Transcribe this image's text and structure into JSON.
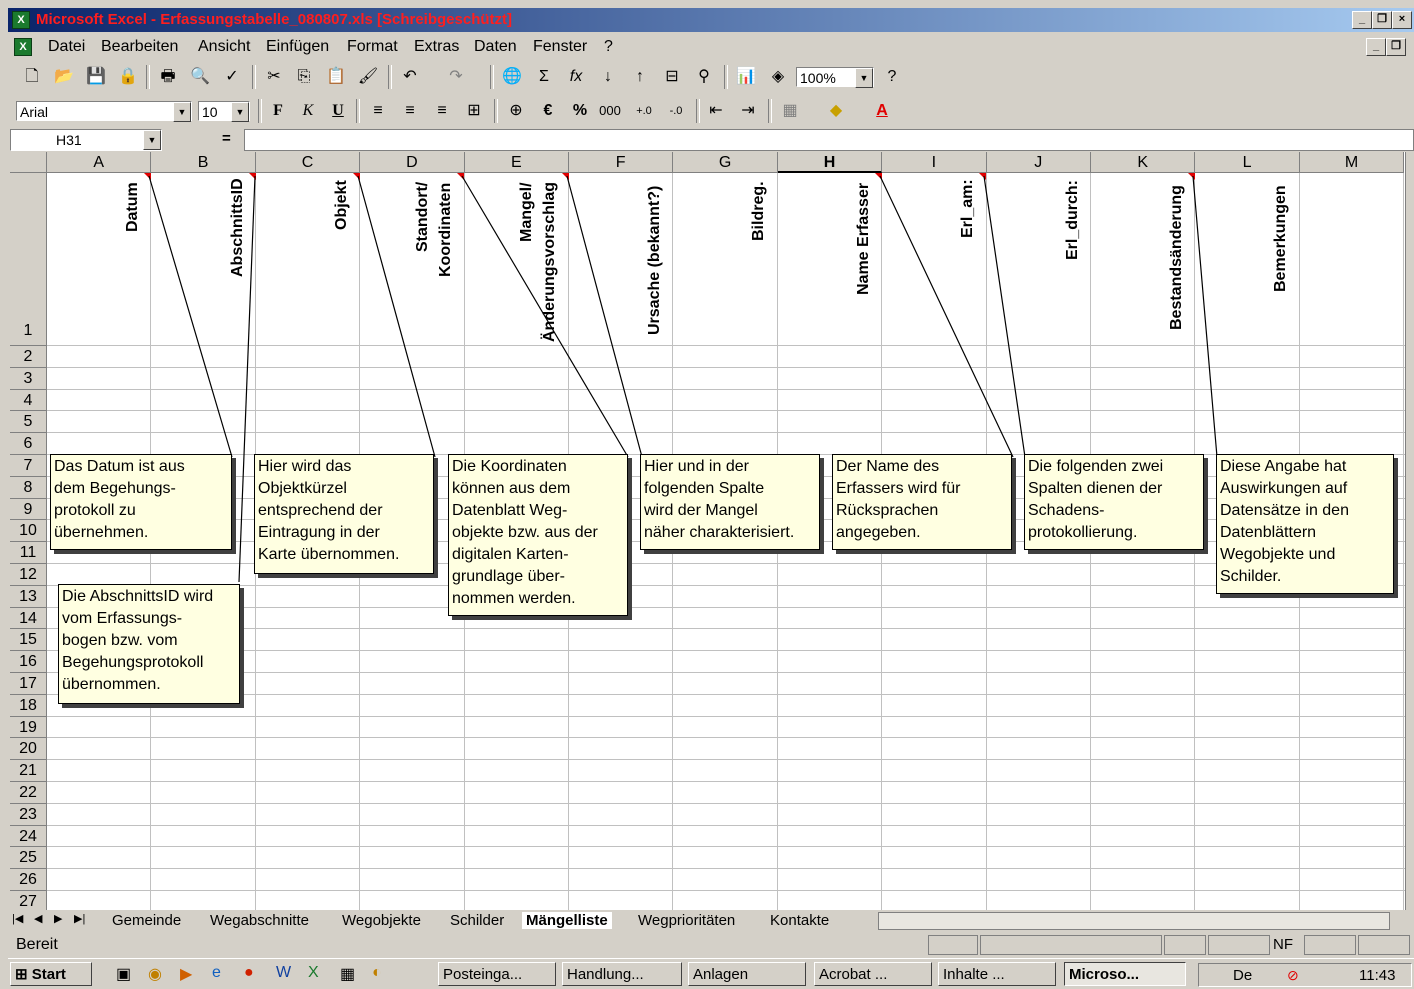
{
  "window": {
    "title": "Microsoft Excel - Erfassungstabelle_080807.xls  [Schreibgeschützt]"
  },
  "menu": [
    "Datei",
    "Bearbeiten",
    "Ansicht",
    "Einfügen",
    "Format",
    "Extras",
    "Daten",
    "Fenster",
    "?"
  ],
  "toolbar": {
    "zoom": "100%",
    "font_name": "Arial",
    "font_size": "10",
    "bold": "F",
    "italic": "K",
    "underline": "U",
    "euro": "€",
    "percent": "%",
    "thousands": "000"
  },
  "formula_bar": {
    "name_box": "H31",
    "equals": "="
  },
  "columns": [
    "A",
    "B",
    "C",
    "D",
    "E",
    "F",
    "G",
    "H",
    "I",
    "J",
    "K",
    "L",
    "M"
  ],
  "rows": [
    "1",
    "2",
    "3",
    "4",
    "5",
    "6",
    "7",
    "8",
    "9",
    "10",
    "11",
    "12",
    "13",
    "14",
    "15",
    "16",
    "17",
    "18",
    "19",
    "20",
    "21",
    "22",
    "23",
    "24",
    "25",
    "26",
    "27"
  ],
  "headers": {
    "A": "Datum",
    "B": "AbschnittsID",
    "C": "Objekt",
    "D1": "Standort/",
    "D2": "Koordinaten",
    "E1": "Mangel/",
    "E2": "Änderungsvorschlag",
    "F": "Ursache (bekannt?)",
    "G": "Bildreg.",
    "H": "Name Erfasser",
    "I": "Erl_am:",
    "J": "Erl_durch:",
    "K": "Bestandsänderung",
    "L": "Bemerkungen"
  },
  "comments": {
    "datum": "Das Datum ist aus\ndem Begehungs-\nprotokoll zu\nübernehmen.",
    "abschnitt": "Die AbschnittsID wird\nvom Erfassungs-\nbogen bzw. vom\nBegehungsprotokoll\nübernommen.",
    "objekt": "Hier wird das\nObjektkürzel\nentsprechend der\nEintragung in der\nKarte übernommen.",
    "koordinaten": "Die Koordinaten\nkönnen aus dem\nDatenblatt Weg-\nobjekte bzw. aus der\ndigitalen Karten-\ngrundlage über-\nnommen werden.",
    "mangel": "Hier und in der\nfolgenden Spalte\nwird der Mangel\nnäher charakterisiert.",
    "erfasser": "Der Name des\nErfassers wird für\nRücksprachen\nangegeben.",
    "schaden": "Die folgenden zwei\nSpalten dienen der\nSchadens-\nprotokollierung.",
    "bestand": "Diese Angabe hat\nAuswirkungen auf\nDatensätze in den\nDatenblättern\nWegobjekte und\nSchilder."
  },
  "sheet_tabs": [
    "Gemeinde",
    "Wegabschnitte",
    "Wegobjekte",
    "Schilder",
    "Mängelliste",
    "Wegprioritäten",
    "Kontakte"
  ],
  "active_tab": "Mängelliste",
  "status": {
    "ready": "Bereit",
    "nf": "NF"
  },
  "taskbar": {
    "start": "Start",
    "items": [
      "Posteinga...",
      "Handlung...",
      "Anlagen",
      "Acrobat ...",
      "Inhalte ...",
      "Microso..."
    ],
    "tray_de": "De",
    "clock": "11:43"
  }
}
